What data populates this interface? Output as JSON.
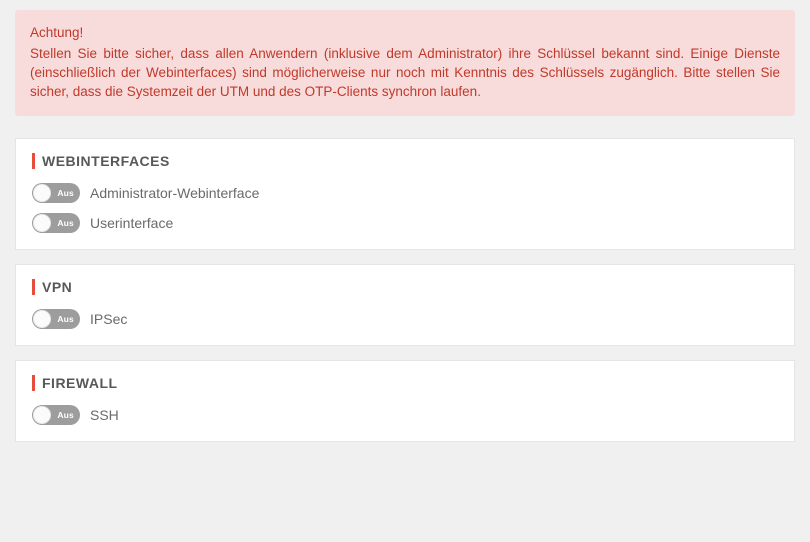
{
  "alert": {
    "title": "Achtung!",
    "body": "Stellen Sie bitte sicher, dass allen Anwendern (inklusive dem Administrator) ihre Schlüssel bekannt sind. Einige Dienste (einschließlich der Webinterfaces) sind möglicherweise nur noch mit Kenntnis des Schlüssels zugänglich. Bitte stellen Sie sicher, dass die Systemzeit der UTM und des OTP-Clients synchron laufen."
  },
  "toggle_off_text": "Aus",
  "panels": [
    {
      "title": "WEBINTERFACES",
      "items": [
        {
          "label": "Administrator-Webinterface",
          "on": false
        },
        {
          "label": "Userinterface",
          "on": false
        }
      ]
    },
    {
      "title": "VPN",
      "items": [
        {
          "label": "IPSec",
          "on": false
        }
      ]
    },
    {
      "title": "FIREWALL",
      "items": [
        {
          "label": "SSH",
          "on": false
        }
      ]
    }
  ]
}
